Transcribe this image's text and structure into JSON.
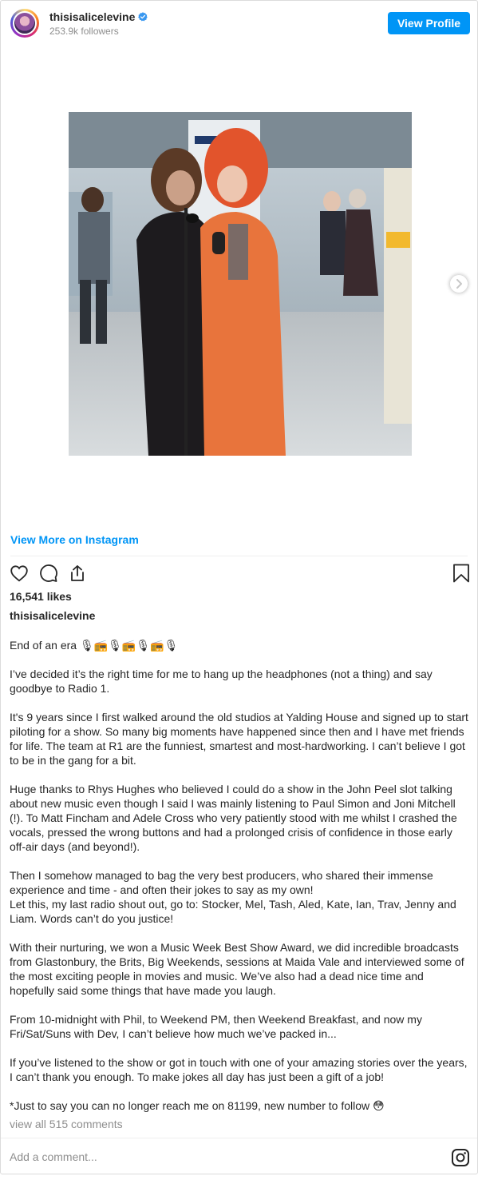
{
  "header": {
    "username": "thisisalicelevine",
    "followers": "253.9k followers",
    "view_profile_label": "View Profile"
  },
  "media": {
    "alt": "Two women singing into a microphone at a train station",
    "view_more_label": "View More on Instagram"
  },
  "actions": {
    "like_icon": "heart-icon",
    "comment_icon": "comment-icon",
    "share_icon": "share-icon",
    "save_icon": "bookmark-icon"
  },
  "likes": "16,541 likes",
  "caption": {
    "username": "thisisalicelevine",
    "paragraphs": [
      "End of an era 🎙📻🎙📻🎙📻🎙",
      "I’ve decided it’s the right time for me to hang up the headphones (not a thing) and say goodbye to Radio 1.",
      "It's 9 years since I first walked around the old studios at Yalding House and signed up to start piloting for a show. So many big moments have happened since then and I have met friends for life. The team at R1 are the funniest, smartest and most-hardworking. I can’t believe I got to be in the gang for a bit.",
      "Huge thanks to Rhys Hughes who believed I could do a show in the John Peel slot talking about new music even though I said I was mainly listening to Paul Simon and Joni Mitchell (!). To Matt Fincham and Adele Cross who very patiently stood with me whilst I crashed the vocals, pressed the wrong buttons and had a prolonged crisis of confidence in those early off-air days (and beyond!).",
      "Then I somehow managed to bag the very best producers, who shared their immense experience and time - and often their jokes to say as my own!\nLet this, my last radio shout out, go to: Stocker, Mel, Tash, Aled, Kate, Ian, Trav, Jenny and Liam. Words can’t do you justice!",
      "With their nurturing, we won a Music Week Best Show Award, we did incredible broadcasts from Glastonbury, the Brits, Big Weekends, sessions at Maida Vale and interviewed some of the most exciting people in movies and music. We’ve also had a dead nice time and hopefully said some things that have made you laugh.",
      "From 10-midnight with Phil, to Weekend PM, then Weekend Breakfast, and now my Fri/Sat/Suns with Dev, I can’t believe how much we’ve packed in...",
      "If you’ve listened to the show or got in touch with one of your amazing stories over the years, I can’t thank you enough. To make jokes all day has just been a gift of a job!",
      "*Just to say you can no longer reach me on 81199, new number to follow 😳"
    ]
  },
  "comments_link": "view all 515 comments",
  "comment_box": {
    "placeholder": "Add a comment..."
  },
  "colors": {
    "accent": "#0095f6",
    "text": "#262626",
    "muted": "#8e8e8e",
    "border": "#dbdbdb"
  }
}
